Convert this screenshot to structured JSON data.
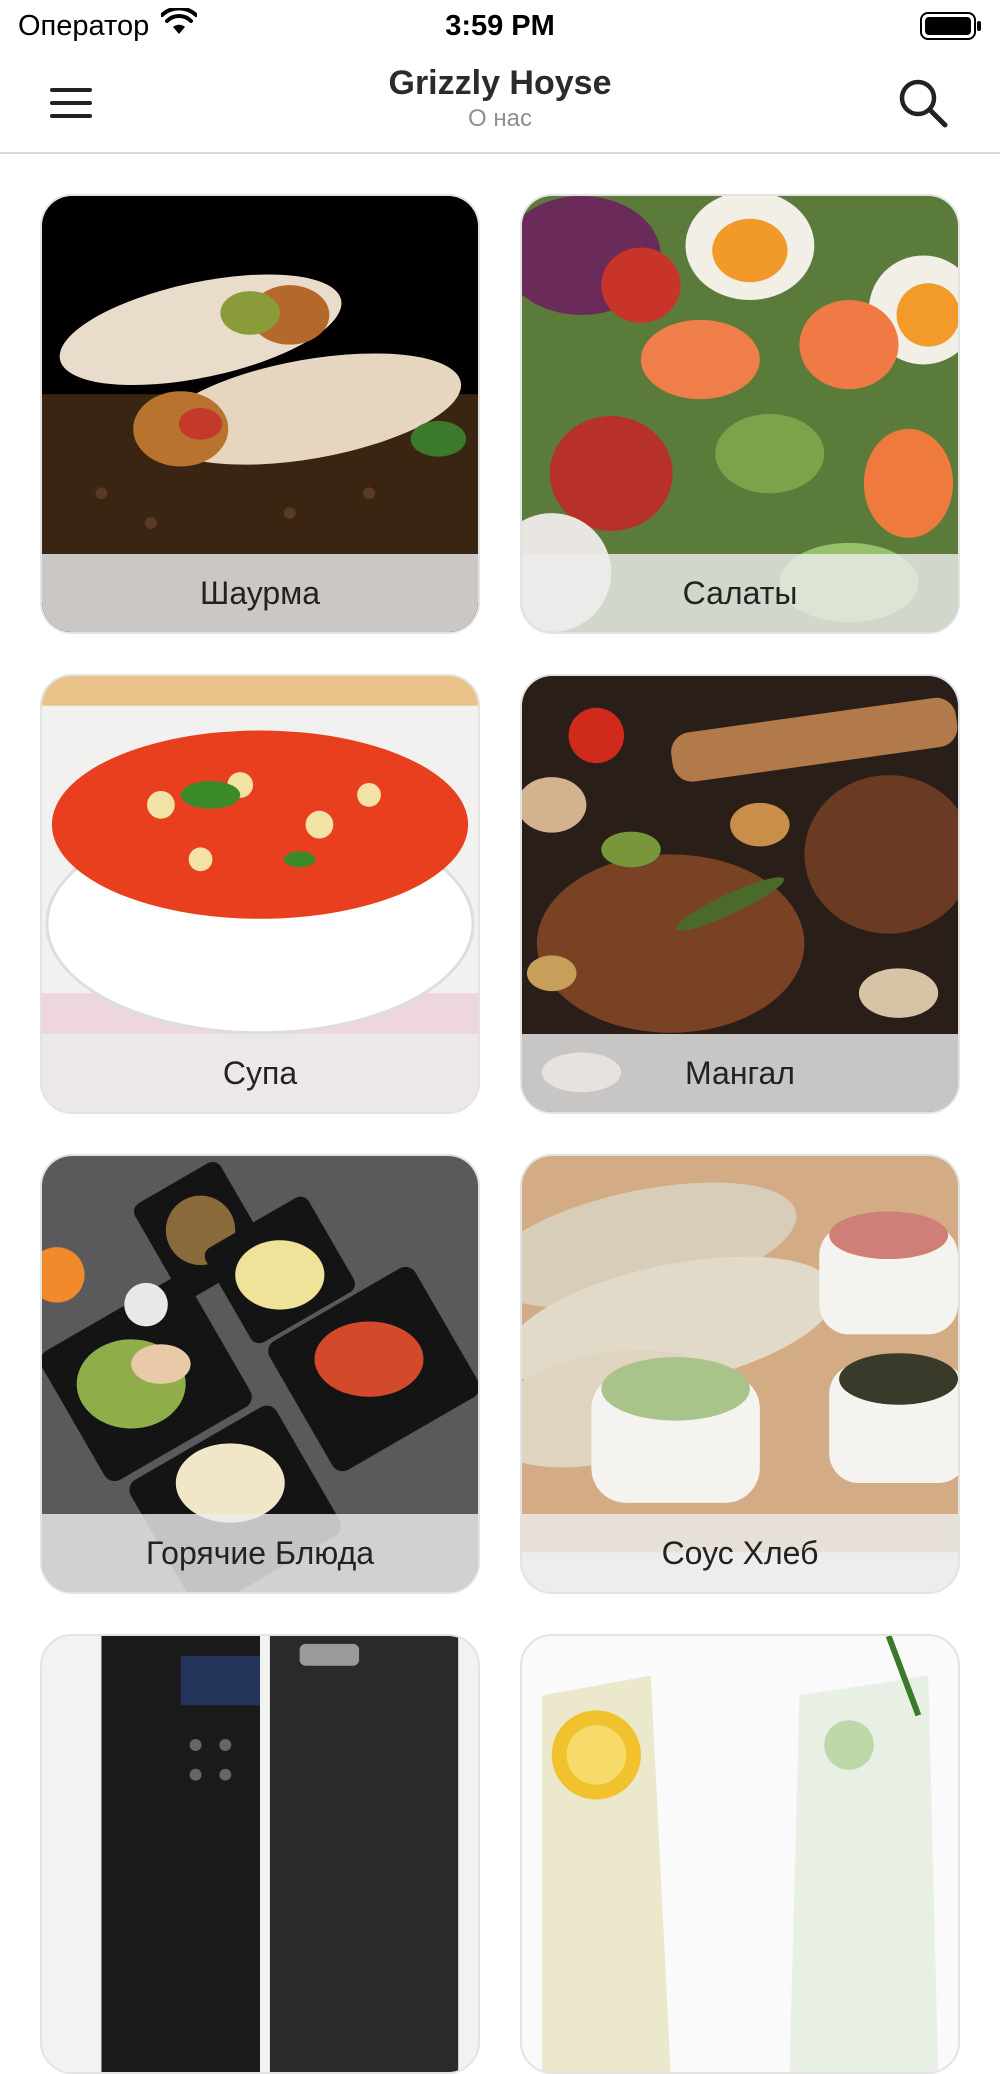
{
  "status_bar": {
    "carrier": "Оператор",
    "time": "3:59 PM"
  },
  "nav": {
    "title": "Grizzly Hoyse",
    "subtitle": "О нас"
  },
  "categories": [
    {
      "label": "Шаурма"
    },
    {
      "label": "Салаты"
    },
    {
      "label": "Супа"
    },
    {
      "label": "Мангал"
    },
    {
      "label": "Горячие Блюда"
    },
    {
      "label": "Соус Хлеб"
    },
    {
      "label": ""
    },
    {
      "label": ""
    }
  ],
  "colors": {
    "nav_border": "#d9d9d9",
    "subtitle": "#8e8e93",
    "label_strip": "#ebebeb"
  }
}
